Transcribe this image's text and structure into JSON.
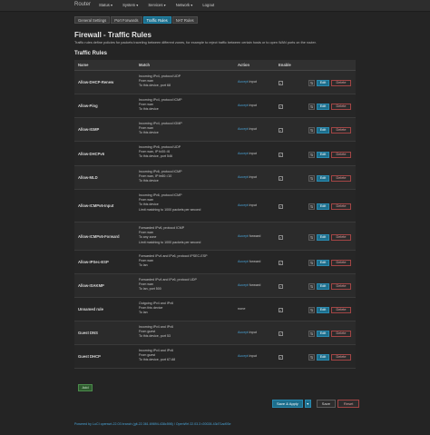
{
  "brand": "Router",
  "nav": [
    "Status ▾",
    "System ▾",
    "Services ▾",
    "Network ▾",
    "Logout"
  ],
  "tabs": [
    {
      "label": "General Settings",
      "active": false
    },
    {
      "label": "Port Forwards",
      "active": false
    },
    {
      "label": "Traffic Rules",
      "active": true
    },
    {
      "label": "NAT Rules",
      "active": false
    }
  ],
  "page": {
    "title": "Firewall - Traffic Rules",
    "description": "Traffic rules define policies for packets traveling between different zones, for example to reject traffic between certain hosts or to open WAN ports on the router.",
    "section_title": "Traffic Rules"
  },
  "table": {
    "headers": [
      "Name",
      "Match",
      "Action",
      "Enable"
    ],
    "rows": [
      {
        "name": "Allow-DHCP-Renew",
        "match": [
          "Incoming IPv4, protocol UDP",
          "From wan",
          "To this device, port 68"
        ],
        "action_link": "Accept",
        "action_rest": "input",
        "enabled": true
      },
      {
        "name": "Allow-Ping",
        "match": [
          "Incoming IPv4, protocol ICMP",
          "From wan",
          "To this device"
        ],
        "action_link": "Accept",
        "action_rest": "input",
        "enabled": true
      },
      {
        "name": "Allow-IGMP",
        "match": [
          "Incoming IPv4, protocol IGMP",
          "From wan",
          "To this device"
        ],
        "action_link": "Accept",
        "action_rest": "input",
        "enabled": true
      },
      {
        "name": "Allow-DHCPv6",
        "match": [
          "Incoming IPv6, protocol UDP",
          "From wan, IP fc00::/6",
          "To this device, port 546"
        ],
        "action_link": "Accept",
        "action_rest": "input",
        "enabled": true
      },
      {
        "name": "Allow-MLD",
        "match": [
          "Incoming IPv6, protocol ICMP",
          "From wan, IP fe80::/10",
          "To this device"
        ],
        "action_link": "Accept",
        "action_rest": "input",
        "enabled": true
      },
      {
        "name": "Allow-ICMPv6-Input",
        "match": [
          "Incoming IPv6, protocol ICMP",
          "From wan",
          "To this device",
          "Limit matching to 1000 packets per second"
        ],
        "action_link": "Accept",
        "action_rest": "input",
        "enabled": true
      },
      {
        "name": "Allow-ICMPv6-Forward",
        "match": [
          "Forwarded IPv6, protocol ICMP",
          "From wan",
          "To any zone",
          "Limit matching to 1000 packets per second"
        ],
        "action_link": "Accept",
        "action_rest": "forward",
        "enabled": true
      },
      {
        "name": "Allow-IPSec-ESP",
        "match": [
          "Forwarded IPv4 and IPv6, protocol IPSEC-ESP",
          "From wan",
          "To lan"
        ],
        "action_link": "Accept",
        "action_rest": "forward",
        "enabled": true
      },
      {
        "name": "Allow-ISAKMP",
        "match": [
          "Forwarded IPv4 and IPv6, protocol UDP",
          "From wan",
          "To lan, port 500"
        ],
        "action_link": "Accept",
        "action_rest": "forward",
        "enabled": true
      },
      {
        "name": "Unnamed rule",
        "match": [
          "Outgoing IPv4 and IPv6",
          "From this device",
          "To lan"
        ],
        "action_link": "",
        "action_rest": "none",
        "enabled": true
      },
      {
        "name": "Guest DNS",
        "match": [
          "Incoming IPv4 and IPv6",
          "From guest",
          "To this device, port 53"
        ],
        "action_link": "Accept",
        "action_rest": "input",
        "enabled": true
      },
      {
        "name": "Guest DHCP",
        "match": [
          "Incoming IPv4 and IPv6",
          "From guest",
          "To this device, port 67-68"
        ],
        "action_link": "Accept",
        "action_rest": "input",
        "enabled": true
      }
    ],
    "edit_label": "Edit",
    "delete_label": "Delete"
  },
  "add_label": "Add",
  "actions": {
    "save_apply": "Save & Apply",
    "save": "Save",
    "reset": "Reset"
  },
  "footer": "Powered by LuCI openwrt-22.03 branch (git-22.361.69894-438c598) / OpenWrt 22.03.3 r20028-43d71ad93e",
  "colors": {
    "accent": "#1c6e8c",
    "link": "#4aa3d6",
    "danger": "#a34545"
  }
}
